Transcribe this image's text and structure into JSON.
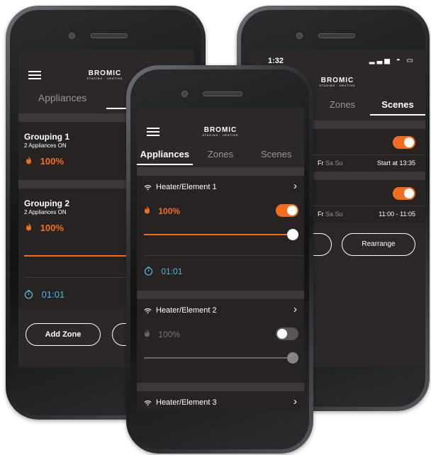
{
  "brand": {
    "name": "BROMIC",
    "tagline": "STAGING · HEATING"
  },
  "left_phone": {
    "tabs": [
      "Appliances",
      "Zones"
    ],
    "active_tab": "Zones",
    "groups": [
      {
        "title": "Grouping 1",
        "subtitle": "2 Appliances ON",
        "value": "100%"
      },
      {
        "title": "Grouping 2",
        "subtitle": "2 Appliances ON",
        "value": "100%"
      }
    ],
    "timer": "01:01",
    "add_zone_label": "Add Zone"
  },
  "right_phone": {
    "status_time": "1:32",
    "tabs": [
      "Zones",
      "Scenes"
    ],
    "active_tab": "Scenes",
    "scenes": [
      {
        "days_label_fr": "Fr",
        "days_label_sasu": "Sa Su",
        "schedule": "Start at 13:35",
        "enabled": true
      },
      {
        "days_label_fr": "Fr",
        "days_label_sasu": "Sa Su",
        "schedule": "11:00 - 11:05",
        "enabled": true
      }
    ],
    "rearrange_label": "Rearrange"
  },
  "center_phone": {
    "tabs": [
      "Appliances",
      "Zones",
      "Scenes"
    ],
    "active_tab": "Appliances",
    "appliances": [
      {
        "name": "Heater/Element 1",
        "value": "100%",
        "enabled": true,
        "level": 1.0,
        "timer": "01:01"
      },
      {
        "name": "Heater/Element 2",
        "value": "100%",
        "enabled": false,
        "level": 1.0
      },
      {
        "name": "Heater/Element 3"
      }
    ]
  },
  "colors": {
    "accent": "#f26d21",
    "timer": "#4fb8e0",
    "screen_bg": "#2d2828"
  }
}
